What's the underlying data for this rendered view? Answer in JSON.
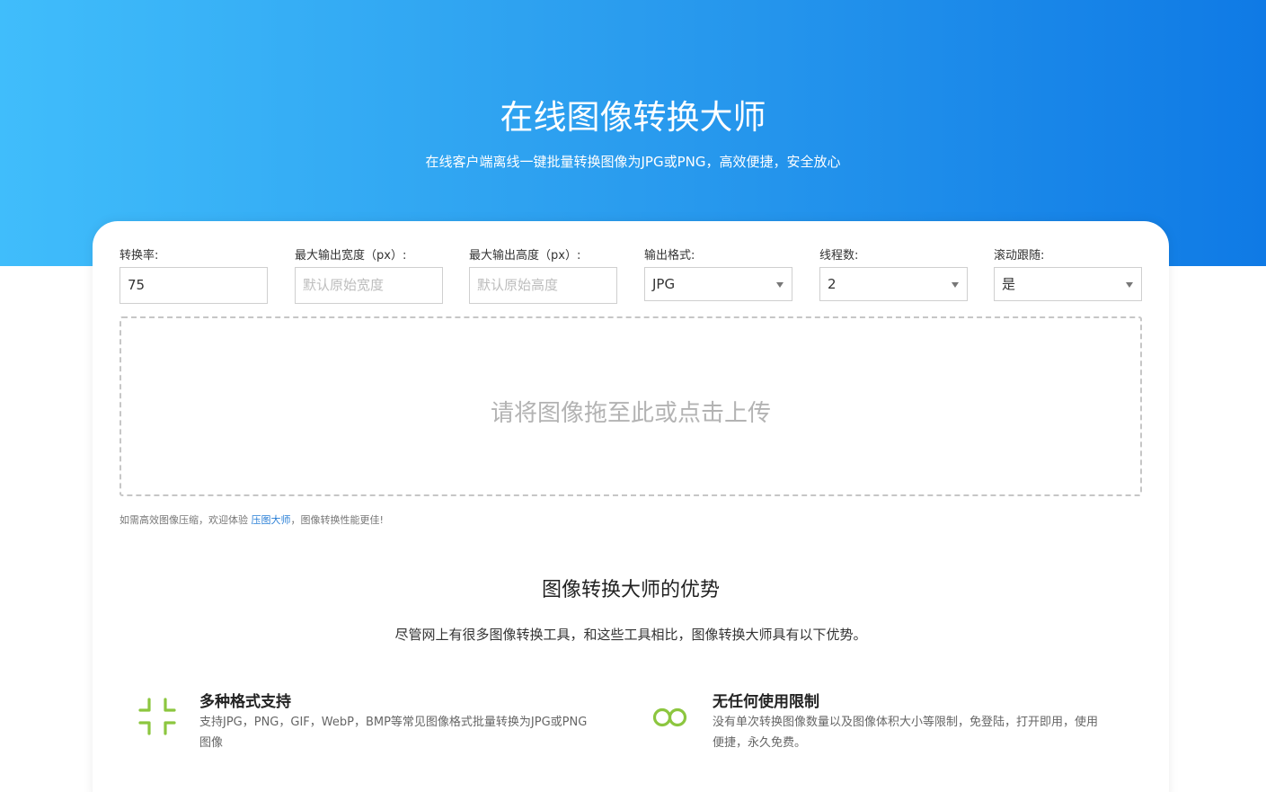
{
  "hero": {
    "title": "在线图像转换大师",
    "subtitle": "在线客户端离线一键批量转换图像为JPG或PNG，高效便捷，安全放心"
  },
  "settings": {
    "ratio": {
      "label": "转换率:",
      "value": "75"
    },
    "max_width": {
      "label": "最大输出宽度（px）:",
      "placeholder": "默认原始宽度"
    },
    "max_height": {
      "label": "最大输出高度（px）:",
      "placeholder": "默认原始高度"
    },
    "format": {
      "label": "输出格式:",
      "value": "JPG"
    },
    "threads": {
      "label": "线程数:",
      "value": "2"
    },
    "scroll_follow": {
      "label": "滚动跟随:",
      "value": "是"
    }
  },
  "dropzone": {
    "text": "请将图像拖至此或点击上传"
  },
  "hint": {
    "prefix": "如需高效图像压缩，欢迎体验 ",
    "link": "压图大师",
    "suffix": "，图像转换性能更佳!"
  },
  "advantages": {
    "title": "图像转换大师的优势",
    "subtitle": "尽管网上有很多图像转换工具，和这些工具相比，图像转换大师具有以下优势。",
    "items": [
      {
        "icon": "compress-arrows-icon",
        "title": "多种格式支持",
        "desc": "支持JPG，PNG，GIF，WebP，BMP等常见图像格式批量转换为JPG或PNG图像"
      },
      {
        "icon": "infinity-icon",
        "title": "无任何使用限制",
        "desc": "没有单次转换图像数量以及图像体积大小等限制，免登陆，打开即用，使用便捷，永久免费。"
      }
    ]
  },
  "colors": {
    "accent": "#1a8cea",
    "icon_green": "#8cc63f",
    "link": "#2a7fd6"
  }
}
